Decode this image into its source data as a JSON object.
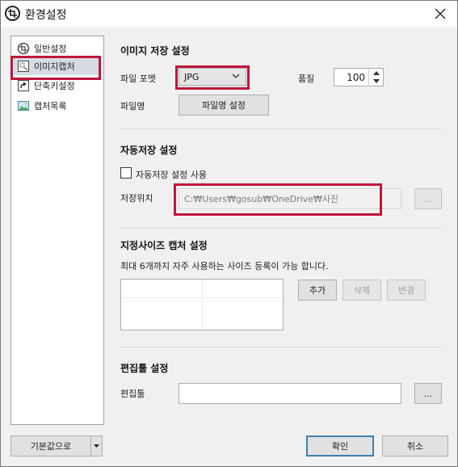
{
  "window": {
    "title": "환경설정"
  },
  "sidebar": {
    "items": [
      {
        "label": "일반설정",
        "icon": "general-settings-icon"
      },
      {
        "label": "이미지캡처",
        "icon": "image-capture-icon",
        "selected": true
      },
      {
        "label": "단축키설정",
        "icon": "shortcut-icon"
      },
      {
        "label": "캡처목록",
        "icon": "capture-list-icon"
      }
    ]
  },
  "image_save": {
    "title": "이미지 저장 설정",
    "format_label": "파일 포멧",
    "format_value": "JPG",
    "quality_label": "품질",
    "quality_value": "100",
    "filename_label": "파일명",
    "filename_button": "파일명 설정"
  },
  "auto_save": {
    "title": "자동저장 설정",
    "enable_label": "자동저장 설정 사용",
    "enabled": false,
    "location_label": "저장위치",
    "location_value": "C:₩Users₩gosub₩OneDrive₩사진",
    "browse_label": "..."
  },
  "custom_size": {
    "title": "지정사이즈 캡처 설정",
    "description": "최대 6개까지 자주 사용하는 사이즈 등록이 가능 합니다.",
    "add_label": "추가",
    "delete_label": "삭제",
    "edit_label": "변경"
  },
  "editor": {
    "title": "편집툴 설정",
    "label": "편집툴",
    "value": "",
    "browse_label": "..."
  },
  "footer": {
    "default_label": "기본값으로",
    "ok_label": "확인",
    "cancel_label": "취소"
  }
}
